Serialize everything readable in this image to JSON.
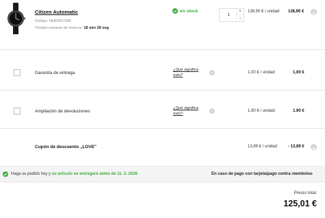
{
  "product": {
    "name": "Citizen Automatic",
    "code": "Código: NH8350-08E",
    "reserve_prefix": "Tiempo restante de reserva: ",
    "reserve_time": "18 min 28 seg",
    "stock": "en stock",
    "quantity": "1",
    "plus": "+",
    "minus": "−",
    "unit_price": "138,90 € / unidad",
    "line_total": "138,90 €"
  },
  "options": [
    {
      "label": "Garantía de entrega",
      "info_link": "¿Qué significa esto?",
      "unit_price": "1,00 € / unidad",
      "line_total": "1,00 €",
      "checked": false
    },
    {
      "label": "Ampliación de devoluciones",
      "info_link": "¿Qué significa esto?",
      "unit_price": "1,90 € / unidad",
      "line_total": "1,90 €",
      "checked": false
    }
  ],
  "coupon": {
    "label": "Cupón de descuento „LOVE\"",
    "unit_price": "13,89 € / unidad",
    "line_total": "- 13,89 €"
  },
  "delivery": {
    "text_prefix": "Haga su pedido hoy y ",
    "text_highlight": "su artículo se entregará antes de 11. 2. 2026",
    "payment_note": "En caso de pago con tarjeta/pago contra reembolso"
  },
  "total": {
    "label": "Precio total",
    "value": "125,01 €"
  },
  "colors": {
    "accent_green": "#3cad3c",
    "icon_grey": "#d4d4d4"
  }
}
